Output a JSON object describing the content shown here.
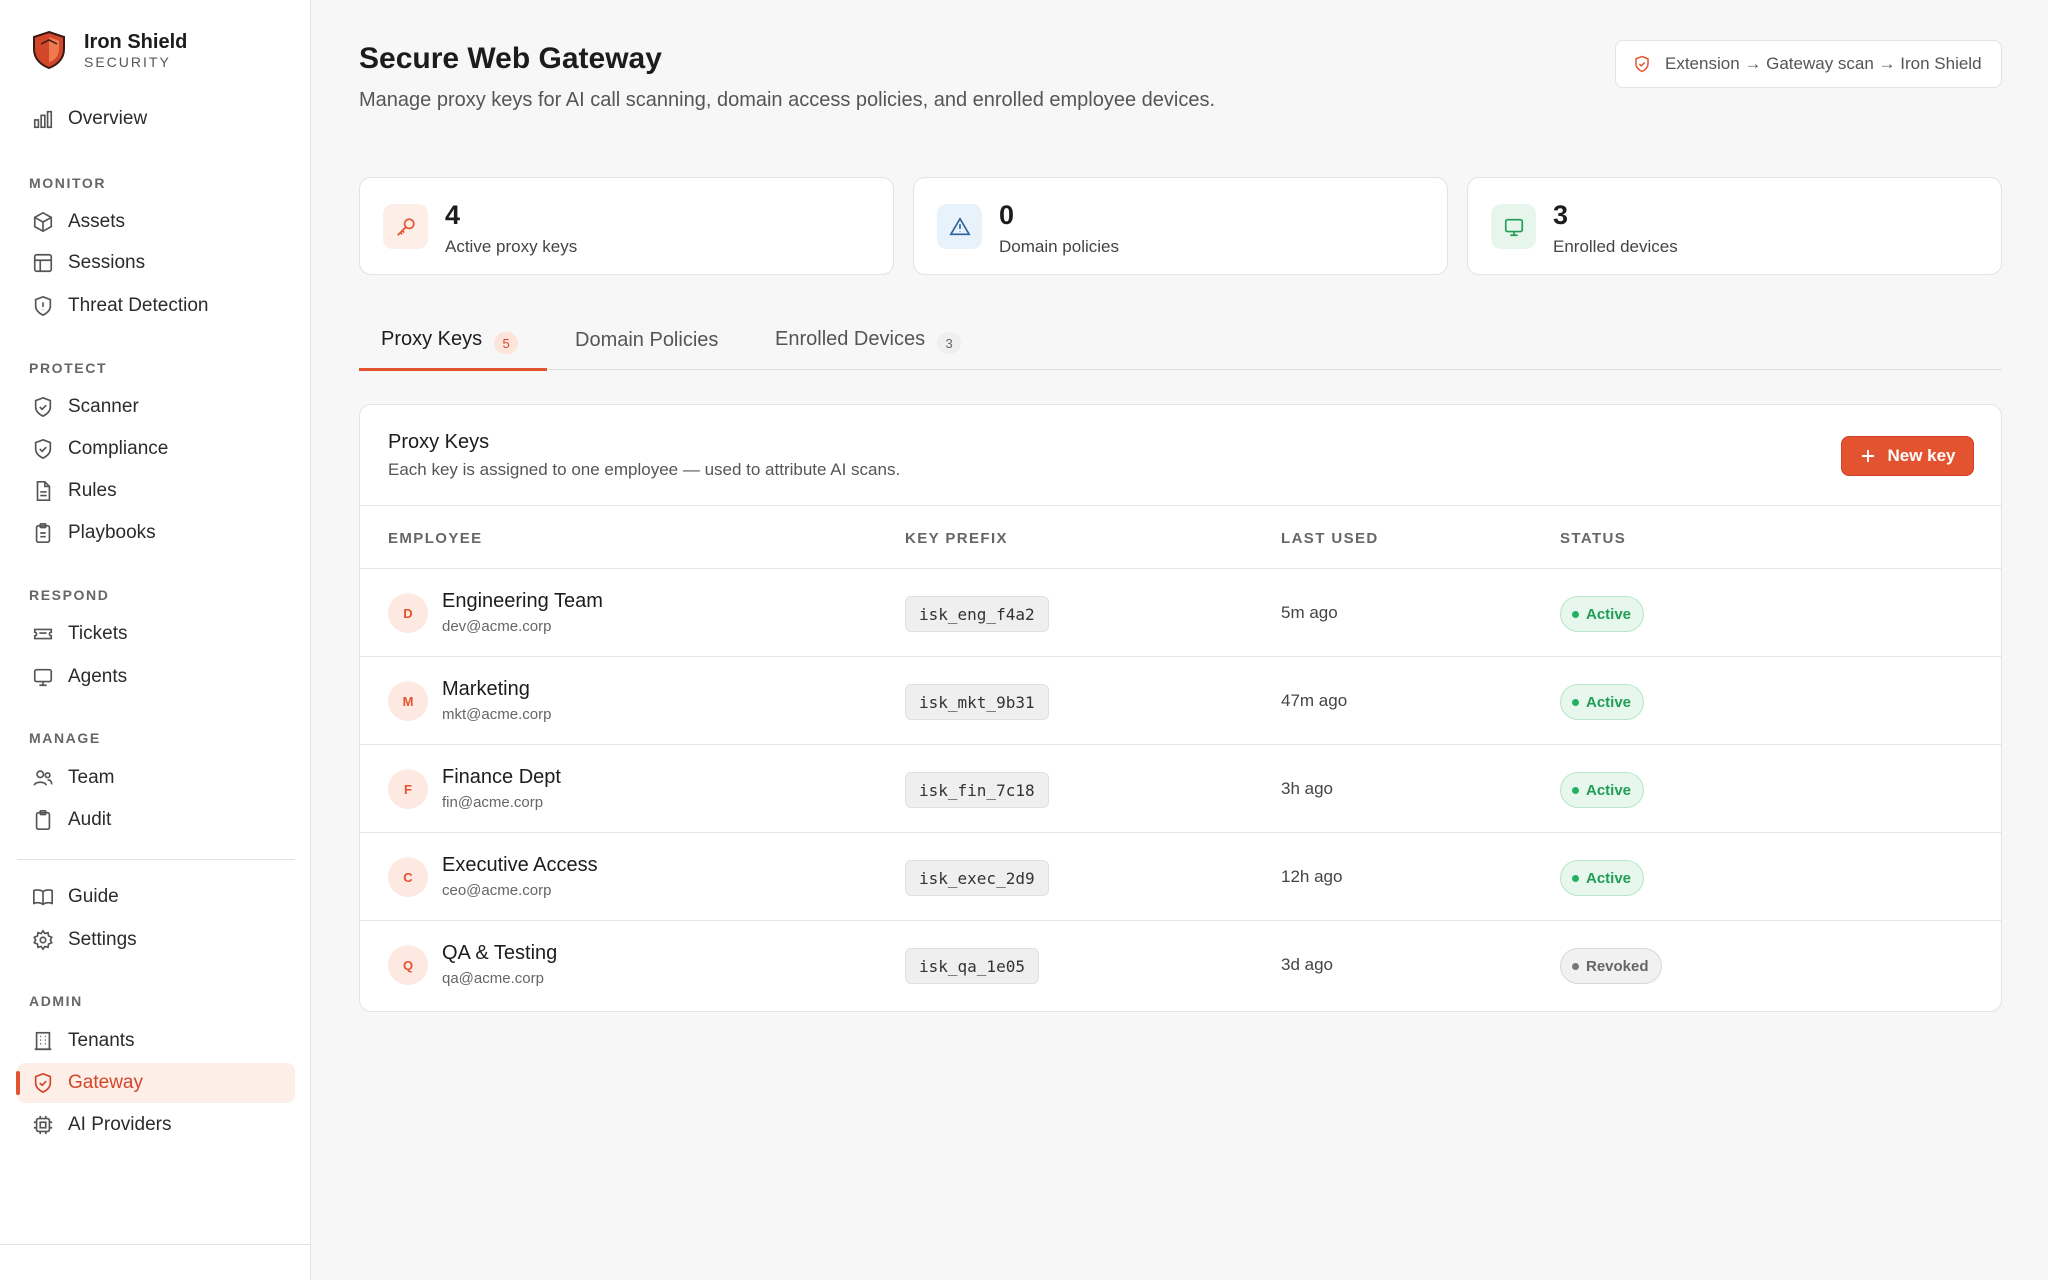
{
  "brand": {
    "name": "Iron Shield",
    "sub": "SECURITY"
  },
  "sidebar": {
    "overview": "Overview",
    "sections": {
      "monitor": "MONITOR",
      "protect": "PROTECT",
      "respond": "RESPOND",
      "manage": "MANAGE",
      "admin": "ADMIN"
    },
    "items": {
      "assets": "Assets",
      "sessions": "Sessions",
      "threat": "Threat Detection",
      "scanner": "Scanner",
      "compliance": "Compliance",
      "rules": "Rules",
      "playbooks": "Playbooks",
      "tickets": "Tickets",
      "agents": "Agents",
      "team": "Team",
      "audit": "Audit",
      "guide": "Guide",
      "settings": "Settings",
      "tenants": "Tenants",
      "gateway": "Gateway",
      "ai_providers": "AI Providers"
    }
  },
  "header": {
    "title": "Secure Web Gateway",
    "description": "Manage proxy keys for AI call scanning, domain access policies, and enrolled employee devices.",
    "flow": "Extension → Gateway scan → Iron Shield"
  },
  "stats": [
    {
      "value": "4",
      "label": "Active proxy keys"
    },
    {
      "value": "0",
      "label": "Domain policies"
    },
    {
      "value": "3",
      "label": "Enrolled devices"
    }
  ],
  "tabs": [
    {
      "label": "Proxy Keys",
      "count": "5"
    },
    {
      "label": "Domain Policies"
    },
    {
      "label": "Enrolled Devices",
      "count": "3"
    }
  ],
  "panel": {
    "title": "Proxy Keys",
    "subtitle": "Each key is assigned to one employee — used to attribute AI scans.",
    "new_key": "New key",
    "columns": [
      "EMPLOYEE",
      "KEY PREFIX",
      "LAST USED",
      "STATUS"
    ],
    "rows": [
      {
        "initial": "D",
        "name": "Engineering Team",
        "email": "dev@acme.corp",
        "prefix": "isk_eng_f4a2",
        "last_used": "5m ago",
        "status": "Active"
      },
      {
        "initial": "M",
        "name": "Marketing",
        "email": "mkt@acme.corp",
        "prefix": "isk_mkt_9b31",
        "last_used": "47m ago",
        "status": "Active"
      },
      {
        "initial": "F",
        "name": "Finance Dept",
        "email": "fin@acme.corp",
        "prefix": "isk_fin_7c18",
        "last_used": "3h ago",
        "status": "Active"
      },
      {
        "initial": "C",
        "name": "Executive Access",
        "email": "ceo@acme.corp",
        "prefix": "isk_exec_2d9",
        "last_used": "12h ago",
        "status": "Active"
      },
      {
        "initial": "Q",
        "name": "QA & Testing",
        "email": "qa@acme.corp",
        "prefix": "isk_qa_1e05",
        "last_used": "3d ago",
        "status": "Revoked"
      }
    ]
  },
  "colors": {
    "accent": "#e4532f",
    "active_green": "#1f9d55",
    "muted": "#666666"
  }
}
